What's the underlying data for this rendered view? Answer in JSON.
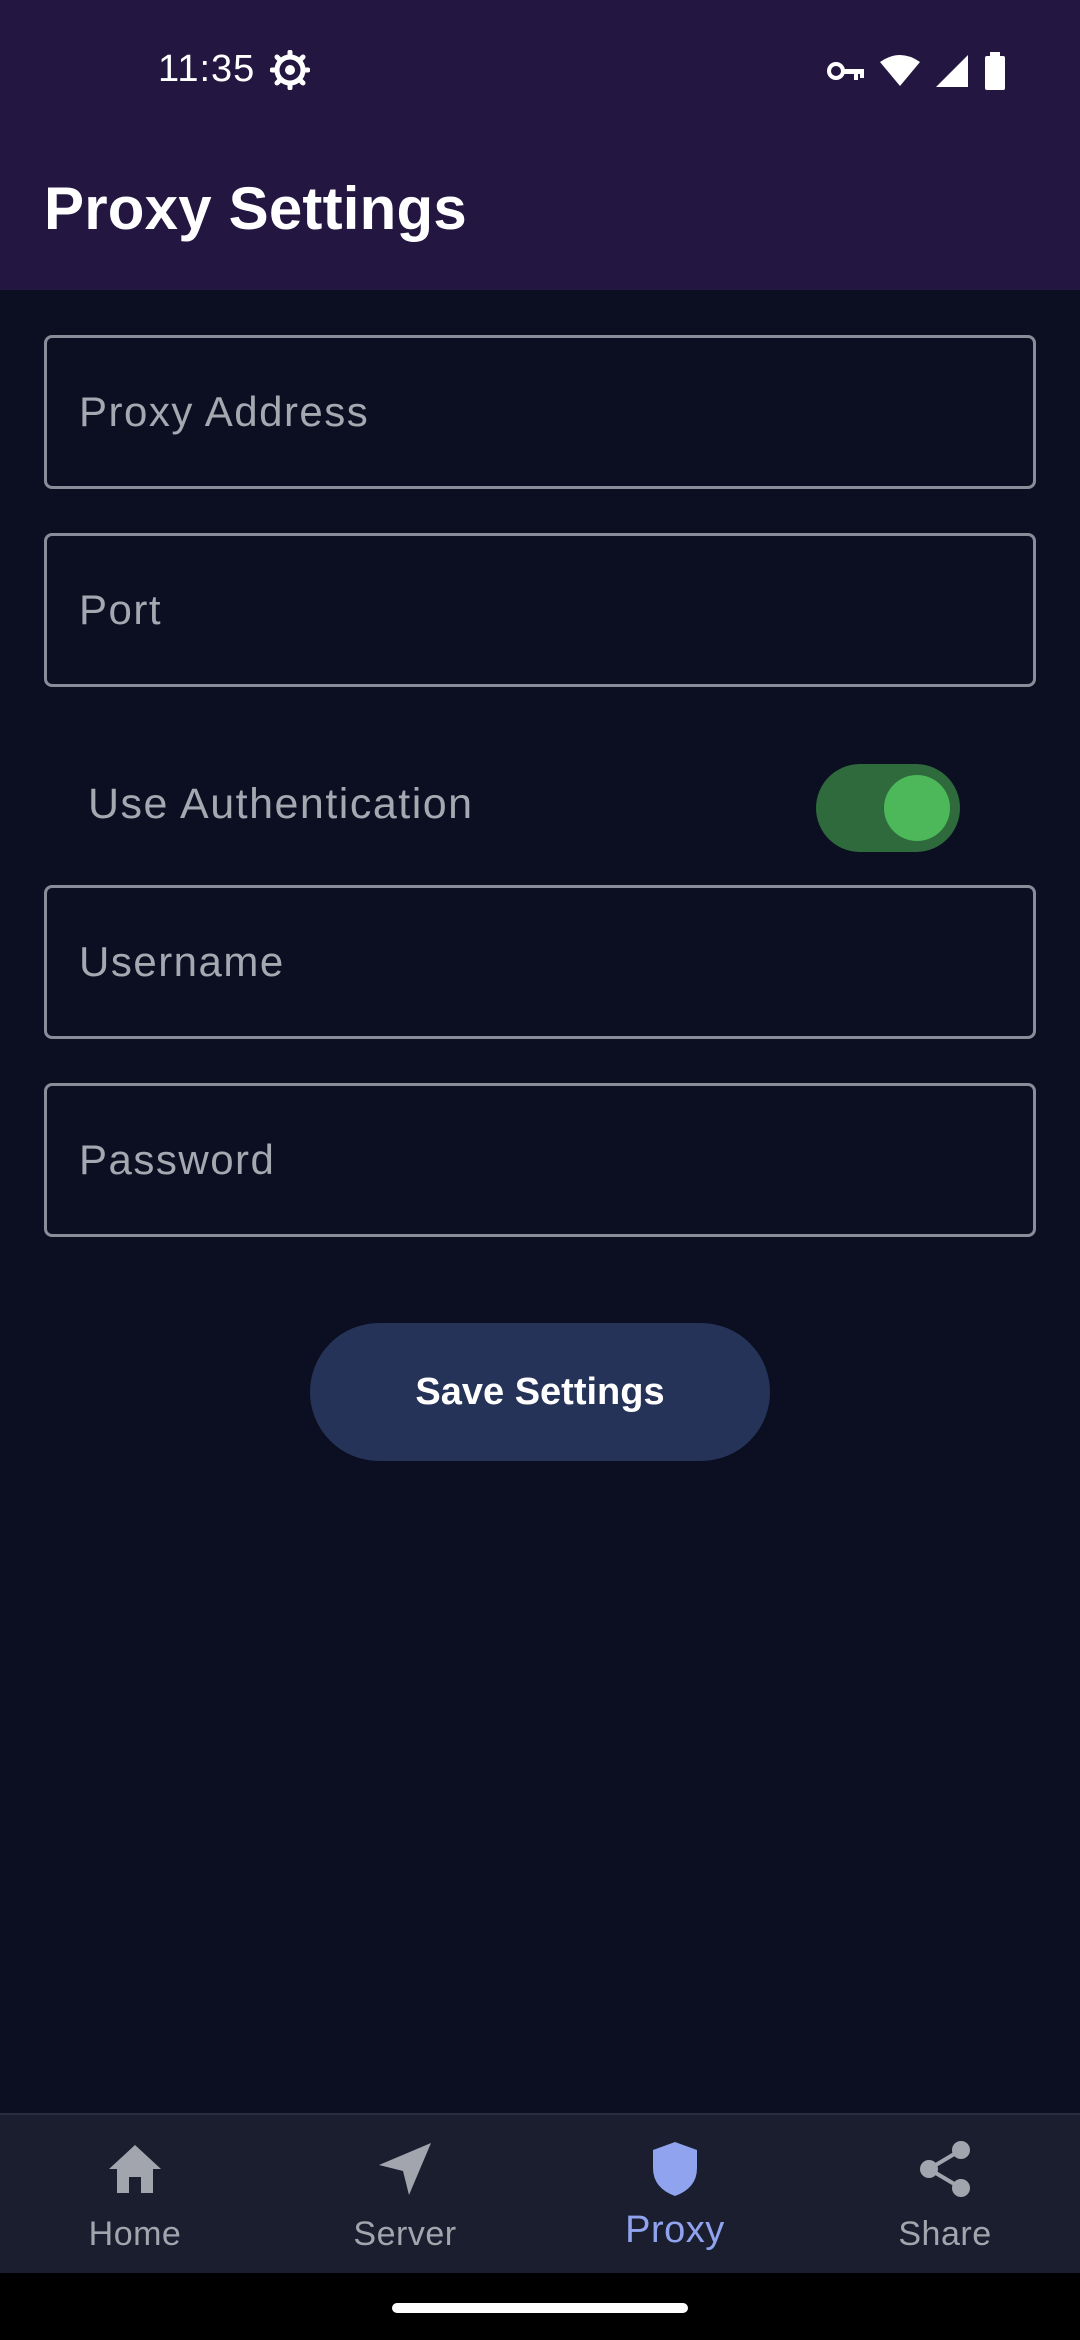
{
  "status_bar": {
    "time": "11:35",
    "icons": [
      "settings-gear-icon",
      "vpn-key-icon",
      "wifi-icon",
      "cellular-signal-icon",
      "battery-icon"
    ]
  },
  "app_bar": {
    "title": "Proxy Settings"
  },
  "form": {
    "proxy_address": {
      "placeholder": "Proxy Address",
      "value": ""
    },
    "port": {
      "placeholder": "Port",
      "value": ""
    },
    "use_authentication": {
      "label": "Use Authentication",
      "enabled": true
    },
    "username": {
      "placeholder": "Username",
      "value": ""
    },
    "password": {
      "placeholder": "Password",
      "value": ""
    },
    "save_label": "Save Settings"
  },
  "bottom_nav": {
    "items": [
      {
        "label": "Home",
        "icon": "home-icon",
        "active": false
      },
      {
        "label": "Server",
        "icon": "navigation-arrow-icon",
        "active": false
      },
      {
        "label": "Proxy",
        "icon": "shield-icon",
        "active": true
      },
      {
        "label": "Share",
        "icon": "share-icon",
        "active": false
      }
    ]
  },
  "colors": {
    "header_bg": "#231640",
    "page_bg": "#0b0f21",
    "toggle_track": "#2f6a3c",
    "toggle_knob": "#4cb85a",
    "button_bg": "#253358",
    "nav_active": "#8fa3ee"
  }
}
